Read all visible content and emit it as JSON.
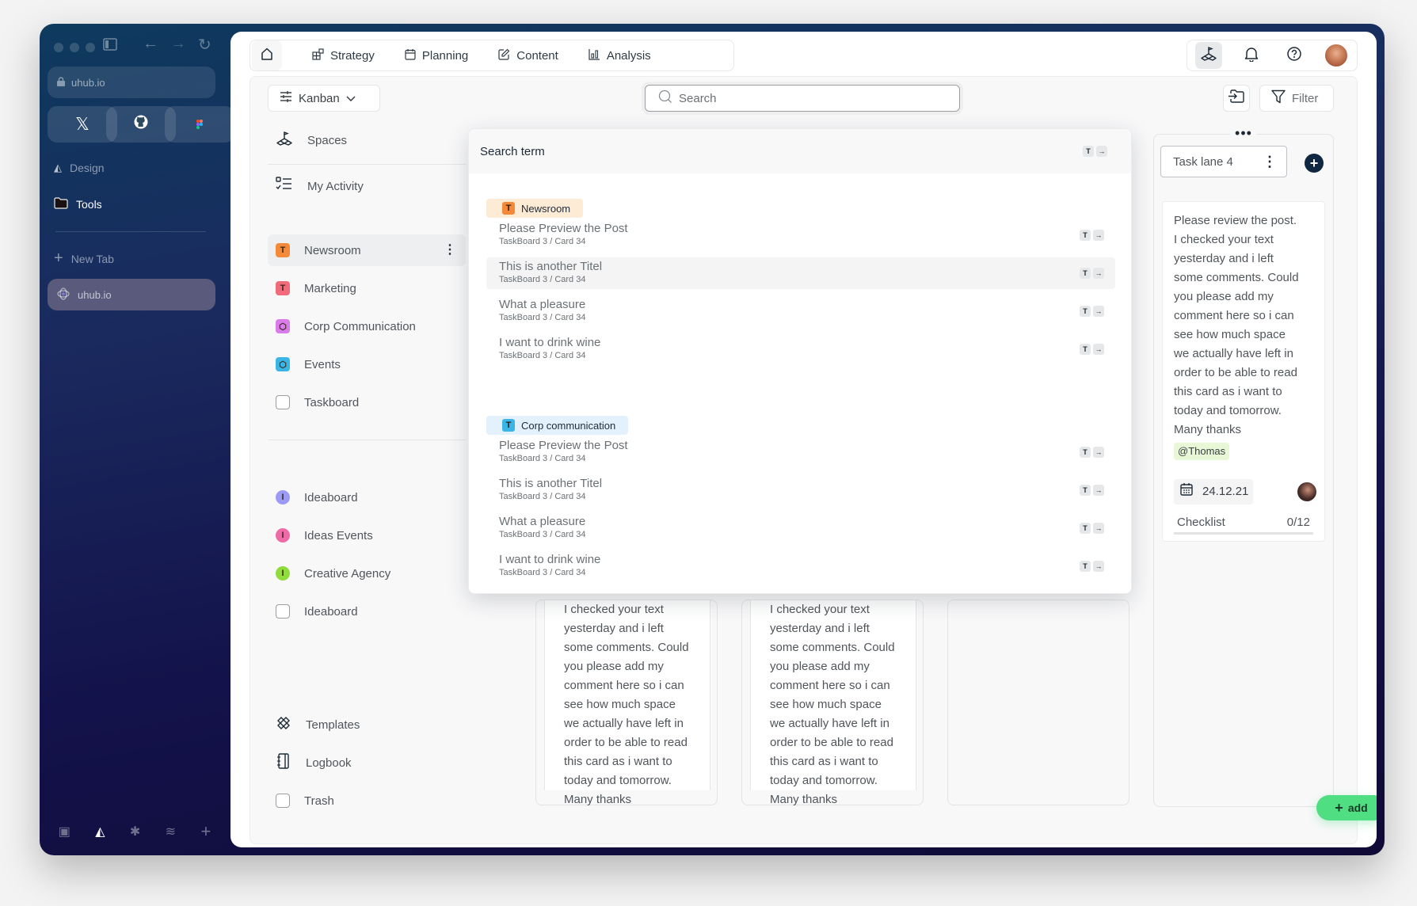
{
  "browser": {
    "url": "uhub.io",
    "favorites": [
      {
        "name": "x",
        "icon": "x-logo-icon"
      },
      {
        "name": "github",
        "icon": "github-icon"
      },
      {
        "name": "figma",
        "icon": "figma-icon"
      }
    ],
    "folders": [
      {
        "label": "Design",
        "icon": "design-icon"
      },
      {
        "label": "Tools",
        "icon": "folder-icon"
      }
    ],
    "new_tab_label": "New Tab",
    "active_tab": "uhub.io"
  },
  "topnav": {
    "tabs": [
      {
        "label": "Strategy",
        "icon": "strategy-icon"
      },
      {
        "label": "Planning",
        "icon": "calendar-icon"
      },
      {
        "label": "Content",
        "icon": "edit-icon"
      },
      {
        "label": "Analysis",
        "icon": "chart-icon"
      }
    ]
  },
  "toolbar": {
    "view_label": "Kanban",
    "search_placeholder": "Search",
    "filter_label": "Filter"
  },
  "sidenav": {
    "top": [
      {
        "label": "Spaces",
        "icon": "spaces-icon"
      },
      {
        "label": "My Activity",
        "icon": "activity-icon"
      }
    ],
    "boards": [
      {
        "label": "Newsroom",
        "badge": "T",
        "color": "#f5893a",
        "active": true
      },
      {
        "label": "Marketing",
        "badge": "T",
        "color": "#f26b7a"
      },
      {
        "label": "Corp Communication",
        "badge": "cube",
        "color": "#d97be8"
      },
      {
        "label": "Events",
        "badge": "cube",
        "color": "#3bb4e6"
      },
      {
        "label": "Taskboard",
        "badge": "box",
        "color": "#ffffff"
      }
    ],
    "ideas": [
      {
        "label": "Ideaboard",
        "badge": "I",
        "color": "#9b9bf5"
      },
      {
        "label": "Ideas Events",
        "badge": "I",
        "color": "#f06aa8"
      },
      {
        "label": "Creative Agency",
        "badge": "I",
        "color": "#8fdc3a"
      },
      {
        "label": "Ideaboard",
        "badge": "box",
        "color": "#ffffff"
      }
    ],
    "bottom": [
      {
        "label": "Templates",
        "icon": "templates-icon"
      },
      {
        "label": "Logbook",
        "icon": "logbook-icon"
      },
      {
        "label": "Trash",
        "icon": "trash-icon"
      }
    ]
  },
  "search_popover": {
    "header": "Search term",
    "groups": [
      {
        "name": "Newsroom",
        "badge": "T",
        "badge_color": "#f5893a",
        "tag_bg": "#fdebd6",
        "results": [
          {
            "title": "Please Preview the Post",
            "path": "TaskBoard 3 / Card 34"
          },
          {
            "title": "This is another Titel",
            "path": "TaskBoard 3 / Card 34",
            "highlighted": true
          },
          {
            "title": "What a pleasure",
            "path": "TaskBoard 3 / Card 34"
          },
          {
            "title": "I want to drink wine",
            "path": "TaskBoard 3 / Card 34"
          }
        ]
      },
      {
        "name": "Corp communication",
        "badge": "T",
        "badge_color": "#3bb4e6",
        "tag_bg": "#e2f1fc",
        "results": [
          {
            "title": "Please Preview the Post",
            "path": "TaskBoard 3 / Card 34"
          },
          {
            "title": "This is another Titel",
            "path": "TaskBoard 3 / Card 34"
          },
          {
            "title": "What a pleasure",
            "path": "TaskBoard 3 / Card 34"
          },
          {
            "title": "I want to drink wine",
            "path": "TaskBoard 3 / Card 34"
          }
        ]
      }
    ],
    "shortcut": [
      "T",
      "→"
    ]
  },
  "board": {
    "card_text_lines": [
      "I checked your text",
      "yesterday and i left",
      "some comments. Could",
      "you please add my",
      "comment here so i can",
      "see how much space",
      "we actually have left in",
      "order to be able to read",
      "this card as i want to",
      "today and tomorrow.",
      "Many thanks"
    ],
    "lane4": {
      "title": "Task lane 4",
      "card": {
        "lines": [
          "Please review the post.",
          "I checked your text",
          "yesterday and i left",
          "some comments. Could",
          "you please add my",
          "comment here so i can",
          "see how much space",
          "we actually have left in",
          "order to be able to read",
          "this card as i want to",
          "today and tomorrow.",
          "Many thanks"
        ],
        "mention": "@Thomas",
        "date": "24.12.21",
        "checklist_label": "Checklist",
        "checklist_value": "0/12"
      }
    },
    "add_label": "add"
  }
}
